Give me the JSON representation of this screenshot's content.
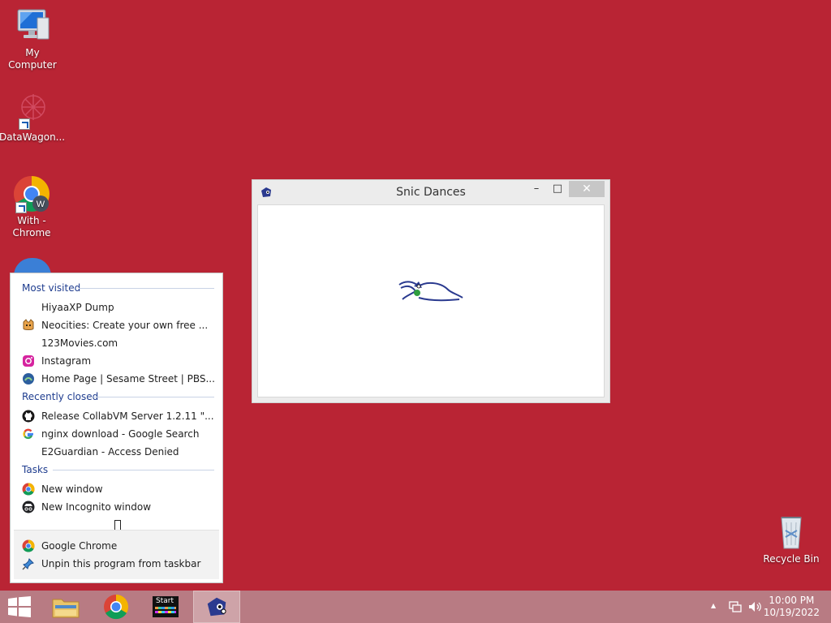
{
  "desktop": {
    "icons": [
      {
        "label": "My Computer"
      },
      {
        "label": "DataWagon..."
      },
      {
        "label": "With - Chrome",
        "line1": "With -",
        "line2": "Chrome"
      },
      {
        "label": "Recycle Bin"
      }
    ]
  },
  "window": {
    "title": "Snic Dances",
    "minimize": "–",
    "maximize": "□",
    "close": "✕"
  },
  "jumplist": {
    "most_visited_header": "Most visited",
    "most_visited": [
      {
        "label": "HiyaaXP Dump",
        "icon": "blank-icon"
      },
      {
        "label": "Neocities: Create your own free ...",
        "icon": "cat-icon"
      },
      {
        "label": "123Movies.com",
        "icon": "blank-icon"
      },
      {
        "label": "Instagram",
        "icon": "instagram-icon"
      },
      {
        "label": "Home Page | Sesame Street | PBS...",
        "icon": "pbs-icon"
      }
    ],
    "recently_closed_header": "Recently closed",
    "recently_closed": [
      {
        "label": "Release CollabVM Server 1.2.11 \"...",
        "icon": "github-icon"
      },
      {
        "label": "nginx download - Google Search",
        "icon": "google-icon"
      },
      {
        "label": "E2Guardian - Access Denied",
        "icon": "blank-icon"
      }
    ],
    "tasks_header": "Tasks",
    "tasks": [
      {
        "label": "New window",
        "icon": "chrome-icon"
      },
      {
        "label": "New Incognito window",
        "icon": "incognito-icon"
      }
    ],
    "footer": [
      {
        "label": "Google Chrome",
        "icon": "chrome-icon"
      },
      {
        "label": "Unpin this program from taskbar",
        "icon": "unpin-icon"
      }
    ]
  },
  "taskbar": {
    "start_label": "Start",
    "tray_expand": "▲",
    "time": "10:00 PM",
    "date": "10/19/2022"
  },
  "colors": {
    "desktop_bg": "#b92434",
    "taskbar_bg": "#b87b83",
    "jumplist_header": "#1f3d8f"
  }
}
